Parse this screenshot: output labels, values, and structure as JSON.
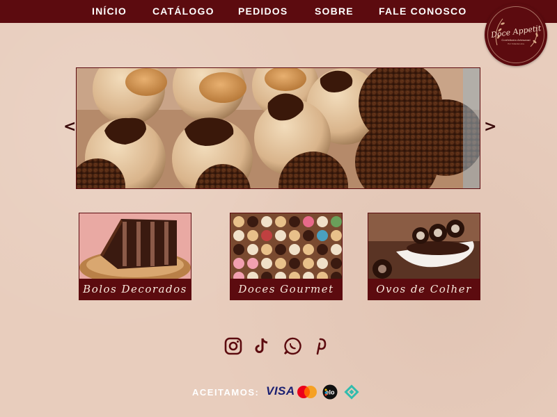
{
  "nav": {
    "items": [
      {
        "label": "INÍCIO"
      },
      {
        "label": "CATÁLOGO"
      },
      {
        "label": "PEDIDOS"
      },
      {
        "label": "SOBRE"
      },
      {
        "label": "FALE CONOSCO"
      }
    ]
  },
  "logo": {
    "name": "Doce Appetit",
    "subtitle": "Confeitaria Artesanal",
    "tagline": "Por Yolanda Lima",
    "icon": "leaf-wreath-icon"
  },
  "carousel": {
    "prev_label": "<",
    "next_label": ">",
    "image": "brigadeiros and doce de leite bonbons"
  },
  "categories": [
    {
      "label": "Bolos Decorados",
      "image": "chocolate layer cake slice"
    },
    {
      "label": "Doces Gourmet",
      "image": "tray of assorted gourmet sweets"
    },
    {
      "label": "Ovos de Colher",
      "image": "chocolate spoon egg with cookies"
    }
  ],
  "social": [
    {
      "icon": "instagram-icon"
    },
    {
      "icon": "tiktok-icon"
    },
    {
      "icon": "whatsapp-icon"
    },
    {
      "icon": "pinterest-icon"
    }
  ],
  "payment": {
    "label": "ACEITAMOS:",
    "methods": [
      {
        "name": "VISA",
        "icon": "visa-logo"
      },
      {
        "icon": "mastercard-logo"
      },
      {
        "icon": "elo-logo"
      },
      {
        "icon": "pix-logo"
      }
    ]
  },
  "colors": {
    "bar": "#5c0b0f",
    "background": "#e8cdbd",
    "nav_text": "#ffffff",
    "label_text": "#f8e9dd"
  }
}
